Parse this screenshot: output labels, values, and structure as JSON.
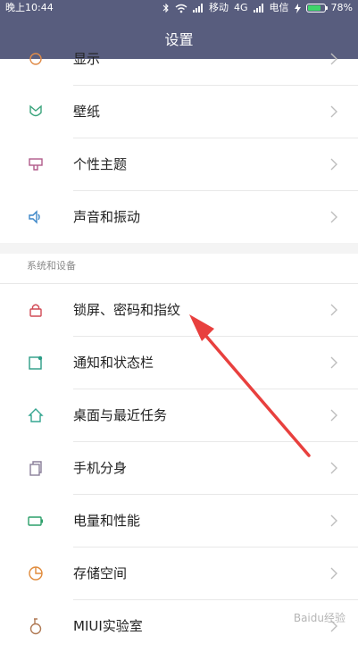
{
  "status": {
    "time": "晚上10:44",
    "carrier1": "移动",
    "network": "4G",
    "carrier2": "电信",
    "battery": "78%",
    "battery_level": 0.78,
    "battery_color": "#3ed46a"
  },
  "header": {
    "title": "设置",
    "bg": "#585d7e"
  },
  "rows_top": [
    {
      "label": "显示"
    },
    {
      "label": "壁纸"
    },
    {
      "label": "个性主题"
    },
    {
      "label": "声音和振动"
    }
  ],
  "section": {
    "title": "系统和设备"
  },
  "rows_bottom": [
    {
      "label": "锁屏、密码和指纹"
    },
    {
      "label": "通知和状态栏"
    },
    {
      "label": "桌面与最近任务"
    },
    {
      "label": "手机分身"
    },
    {
      "label": "电量和性能"
    },
    {
      "label": "存储空间"
    },
    {
      "label": "MIUI实验室"
    }
  ],
  "watermark": "Baidu经验",
  "colors": {
    "accent_arrow": "#e8403e"
  }
}
